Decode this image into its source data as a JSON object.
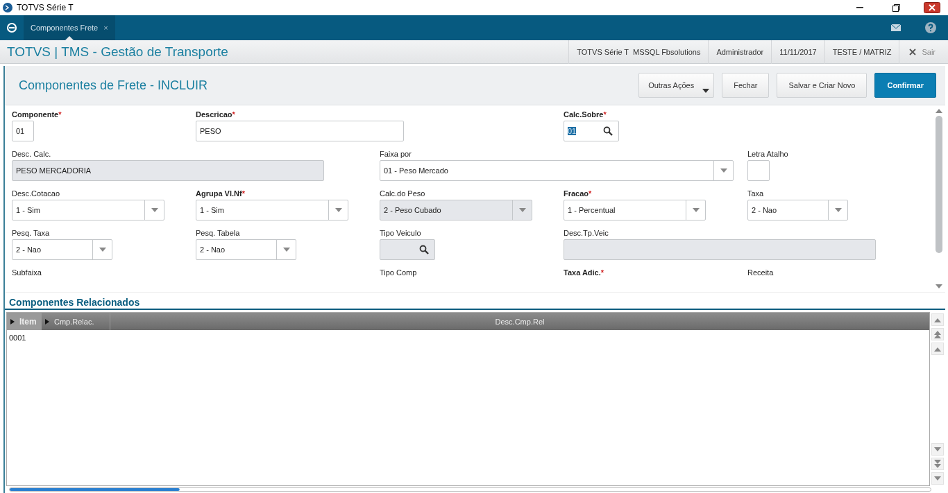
{
  "window": {
    "title": "TOTVS Série T"
  },
  "tabs": [
    {
      "label": "Componentes Frete",
      "selected": true,
      "close": "×"
    }
  ],
  "header": {
    "title": "TOTVS | TMS - Gestão de Transporte",
    "info": [
      "TOTVS Série T  MSSQL Fbsolutions",
      "Administrador",
      "11/11/2017",
      "TESTE / MATRIZ"
    ],
    "exit": "Sair"
  },
  "page": {
    "title": "Componentes de Frete - INCLUIR",
    "actions": [
      {
        "label": "Outras Ações",
        "kind": "menu"
      },
      {
        "label": "Fechar",
        "kind": "default"
      },
      {
        "label": "Salvar e Criar Novo",
        "kind": "default"
      },
      {
        "label": "Confirmar",
        "kind": "primary"
      }
    ]
  },
  "form": {
    "rows": [
      [
        {
          "label": "Componente",
          "required_mark": "*",
          "kind": "text",
          "value": "01",
          "disabled": false
        },
        {
          "label": "Descricao",
          "required_mark": "*",
          "kind": "text",
          "value": "PESO",
          "disabled": false
        },
        "",
        {
          "label": "Calc.Sobre",
          "required_mark": "*",
          "kind": "lookup",
          "value": "01",
          "disabled": false,
          "highlighted": true
        }
      ],
      [
        {
          "label": "Desc. Calc.",
          "kind": "text",
          "value": "PESO MERCADORIA",
          "disabled": true
        },
        "",
        {
          "label": "Faixa por",
          "kind": "select",
          "value": "01 - Peso Mercado",
          "disabled": false
        },
        "",
        {
          "label": "Letra Atalho",
          "kind": "text",
          "disabled": false
        }
      ],
      [
        {
          "label": "Desc.Cotacao",
          "kind": "select",
          "value": "1 - Sim",
          "disabled": false
        },
        {
          "label": "Agrupa Vl.Nf",
          "required_mark": "*",
          "kind": "select",
          "value": "1 - Sim",
          "disabled": false
        },
        {
          "label": "Calc.do Peso",
          "kind": "select",
          "value": "2 - Peso Cubado",
          "disabled": true
        },
        {
          "label": "Fracao",
          "required_mark": "*",
          "kind": "select",
          "value": "1 - Percentual",
          "disabled": false
        },
        {
          "label": "Taxa",
          "kind": "select",
          "value": "2 - Nao",
          "disabled": false
        }
      ],
      [
        {
          "label": "Pesq. Taxa",
          "kind": "select",
          "value": "2 - Nao",
          "disabled": false
        },
        {
          "label": "Pesq. Tabela",
          "kind": "select",
          "value": "2 - Nao",
          "disabled": false
        },
        {
          "label": "Tipo Veiculo",
          "kind": "lookup",
          "disabled": true
        },
        {
          "label": "Desc.Tp.Veic",
          "kind": "text",
          "disabled": true
        },
        ""
      ],
      [
        {
          "label": "Subfaixa",
          "kind": "label"
        },
        "",
        {
          "label": "Tipo Comp",
          "kind": "label"
        },
        {
          "label": "Taxa Adic.",
          "required_mark": "*",
          "kind": "label"
        },
        {
          "label": "Receita",
          "kind": "label"
        }
      ]
    ]
  },
  "related": {
    "title": "Componentes Relacionados",
    "columns": [
      {
        "label": "Item",
        "selected": true
      },
      {
        "label": "Cmp.Relac.",
        "selected": false
      },
      {
        "label": "Desc.Cmp.Rel",
        "selected": false
      }
    ],
    "rows": [
      [
        "0001"
      ]
    ]
  }
}
